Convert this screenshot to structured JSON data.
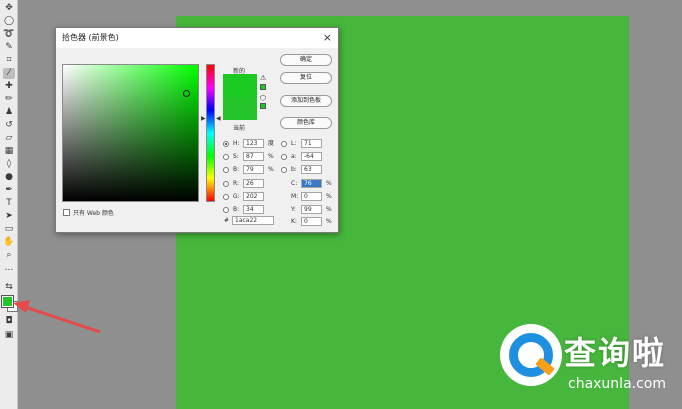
{
  "colors": {
    "canvas": "#46b63c",
    "picked": "#1aca22",
    "current": "#23c52a",
    "arrow": "#e8494c"
  },
  "toolbar": {
    "icons": [
      "move-icon",
      "ellipse-marquee-icon",
      "lasso-icon",
      "quick-select-icon",
      "crop-icon",
      "eyedropper-icon",
      "healing-icon",
      "brush-icon",
      "stamp-icon",
      "history-brush-icon",
      "eraser-icon",
      "gradient-icon",
      "blur-icon",
      "dodge-icon",
      "pen-icon",
      "text-icon",
      "path-select-icon",
      "shape-icon",
      "hand-icon",
      "zoom-icon",
      "more-icon"
    ]
  },
  "dialog": {
    "title": "拾色器 (前景色)",
    "close": "×",
    "new_label": "新的",
    "current_label": "当前",
    "buttons": {
      "ok": "确定",
      "reset": "复位",
      "add_swatch": "添加到色板",
      "libraries": "颜色库"
    },
    "web_only": "只有 Web 颜色",
    "fields": {
      "H": {
        "label": "H:",
        "value": "123",
        "unit": "度"
      },
      "S": {
        "label": "S:",
        "value": "87",
        "unit": "%"
      },
      "B": {
        "label": "B:",
        "value": "79",
        "unit": "%"
      },
      "R": {
        "label": "R:",
        "value": "26",
        "unit": ""
      },
      "G": {
        "label": "G:",
        "value": "202",
        "unit": ""
      },
      "Bl": {
        "label": "B:",
        "value": "34",
        "unit": ""
      },
      "L": {
        "label": "L:",
        "value": "71",
        "unit": ""
      },
      "a": {
        "label": "a:",
        "value": "-64",
        "unit": ""
      },
      "b": {
        "label": "b:",
        "value": "63",
        "unit": ""
      },
      "C": {
        "label": "C:",
        "value": "76",
        "unit": "%"
      },
      "M": {
        "label": "M:",
        "value": "0",
        "unit": "%"
      },
      "Y": {
        "label": "Y:",
        "value": "99",
        "unit": "%"
      },
      "K": {
        "label": "K:",
        "value": "0",
        "unit": "%"
      }
    },
    "hex_label": "#",
    "hex_value": "1aca22"
  },
  "watermark": {
    "cn": "查询啦",
    "en": "chaxunla.com"
  }
}
